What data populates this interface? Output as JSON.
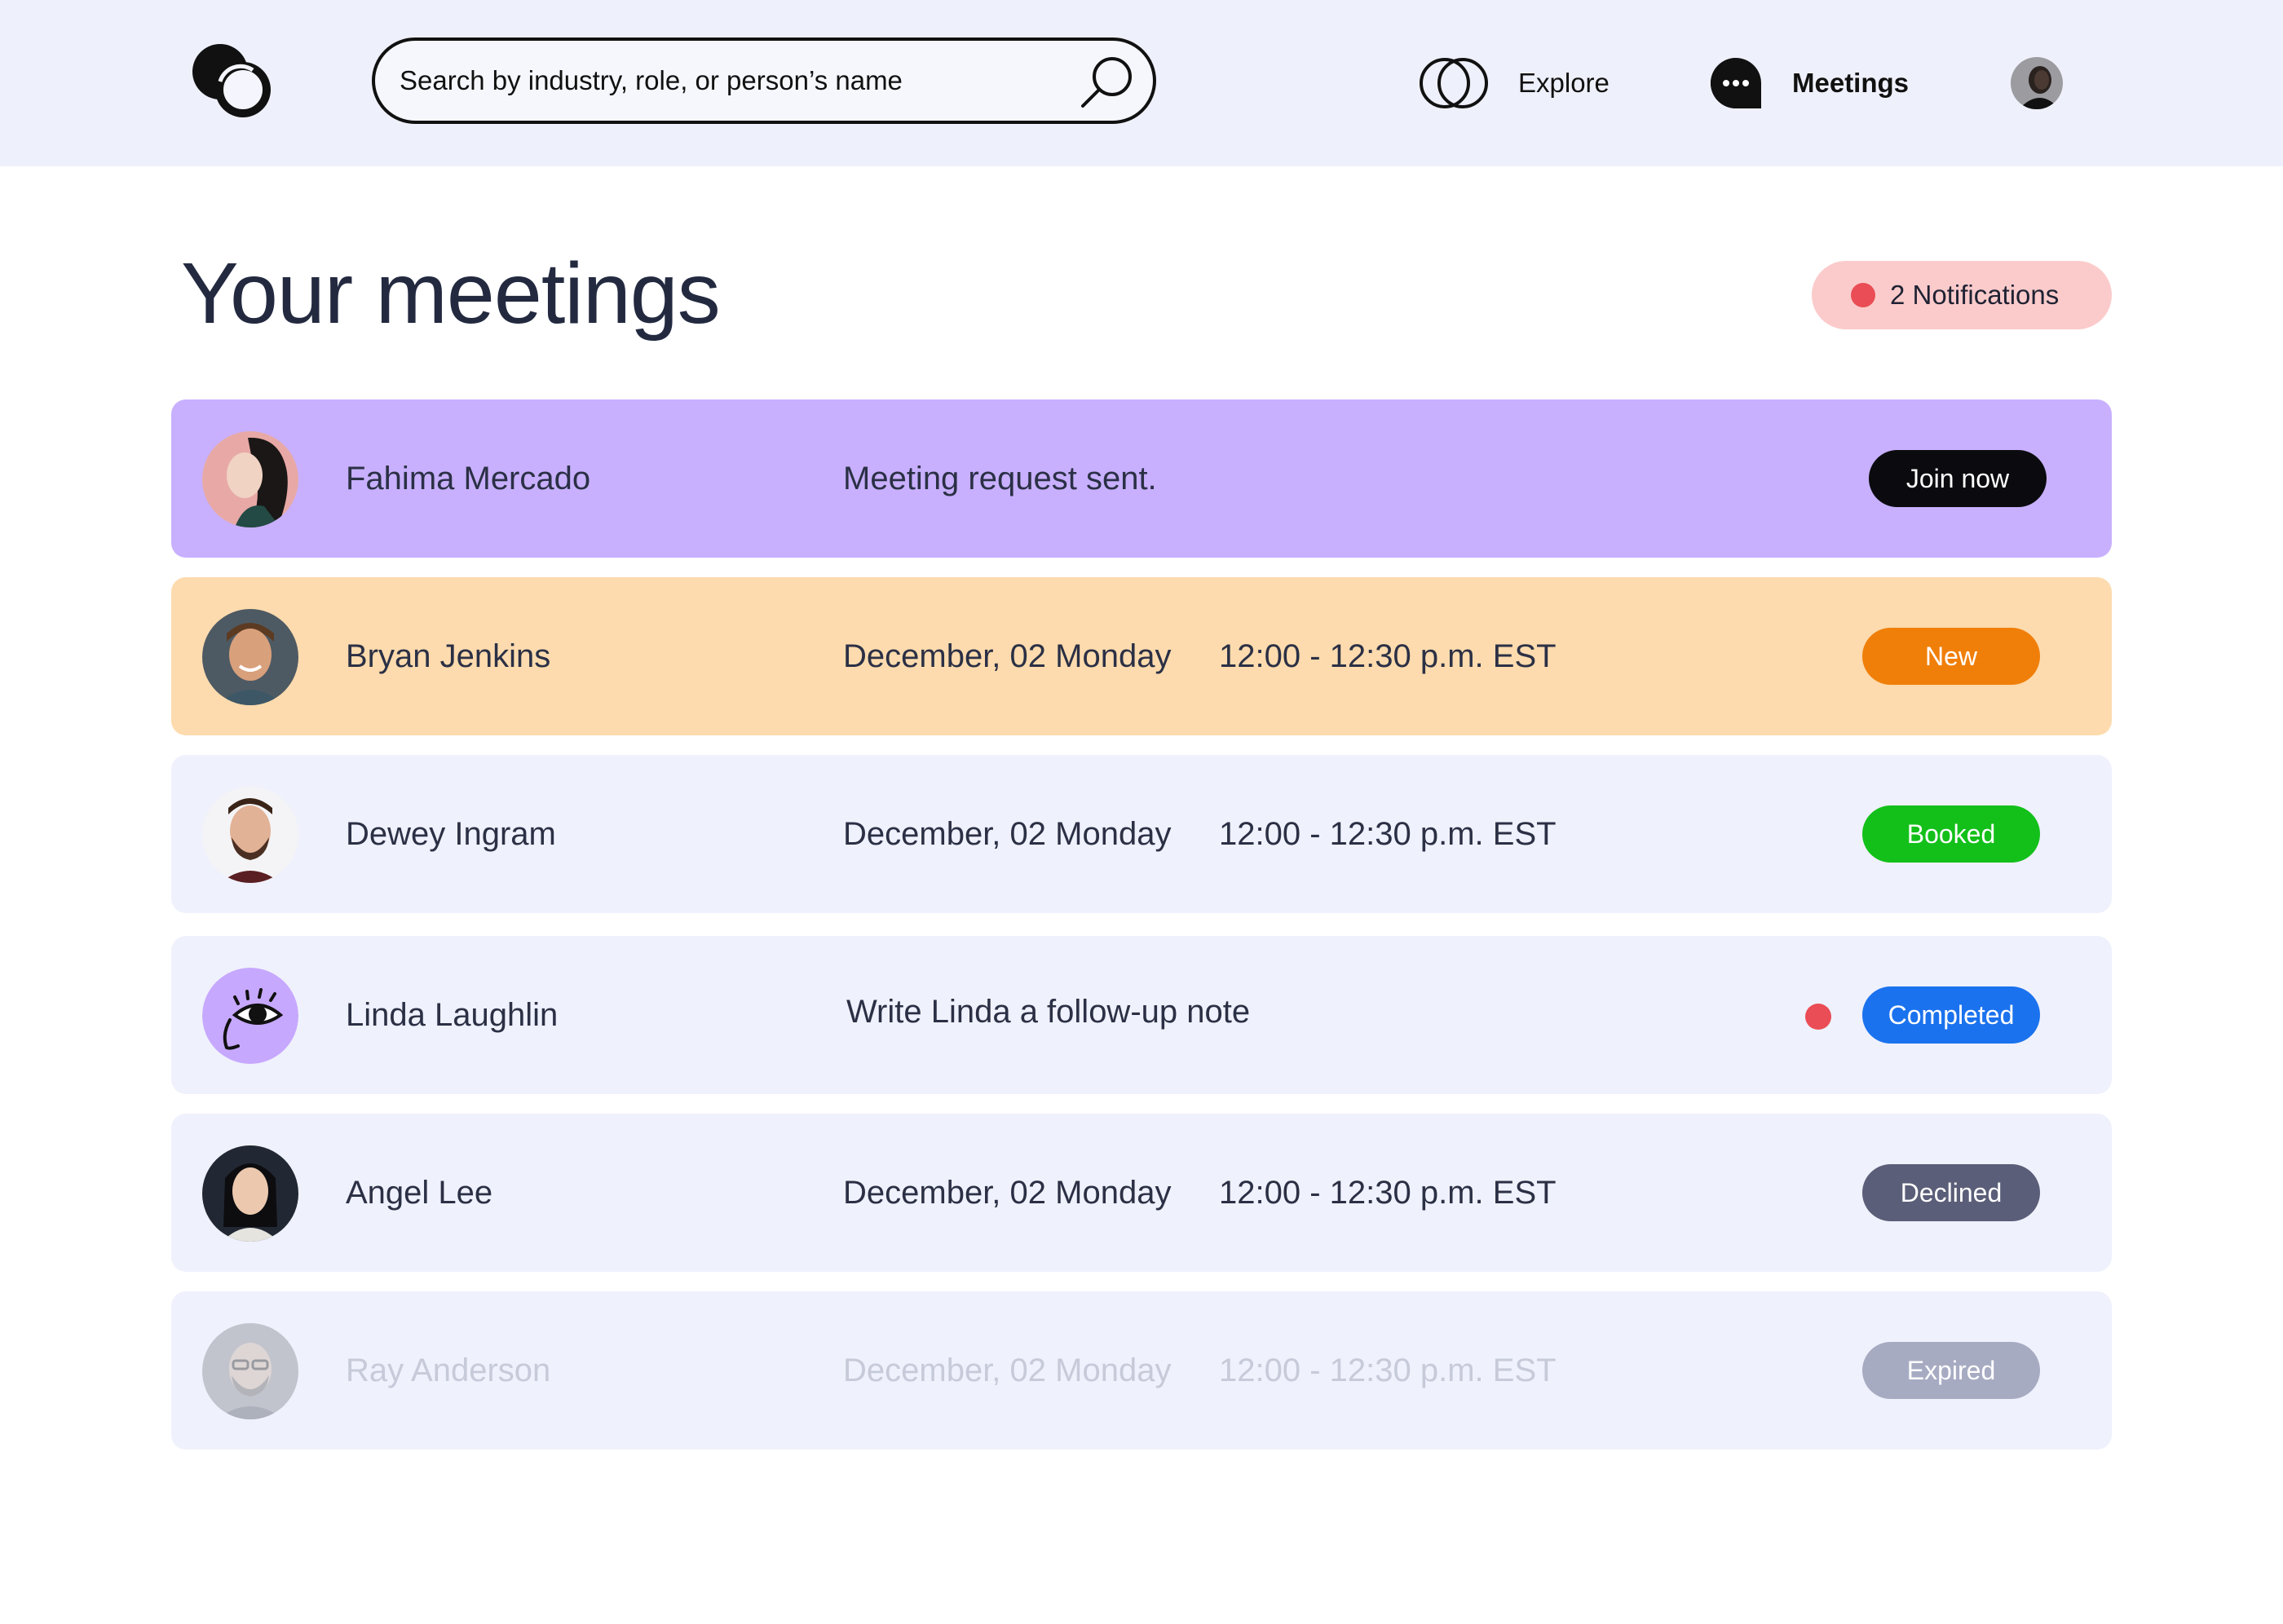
{
  "header": {
    "search_placeholder": "Search by industry, role, or person’s name",
    "nav": {
      "explore_label": "Explore",
      "meetings_label": "Meetings"
    }
  },
  "page": {
    "title": "Your meetings",
    "notifications_label": "2 Notifications"
  },
  "meetings": [
    {
      "name": "Fahima Mercado",
      "message": "Meeting request sent.",
      "action": "Join now",
      "color": "#c8b0ff"
    },
    {
      "name": "Bryan Jenkins",
      "date": "December, 02 Monday",
      "time": "12:00 - 12:30 p.m. EST",
      "status": "New",
      "color": "#fddbae",
      "status_color": "#f07f0a"
    },
    {
      "name": "Dewey Ingram",
      "date": "December, 02 Monday",
      "time": "12:00 - 12:30 p.m. EST",
      "status": "Booked",
      "color": "#eff1fc",
      "status_color": "#13c01a"
    },
    {
      "name": "Linda Laughlin",
      "message": "Write Linda a follow-up note",
      "status": "Completed",
      "color": "#eff1fc",
      "status_color": "#1b72ee"
    },
    {
      "name": "Angel Lee",
      "date": "December, 02 Monday",
      "time": "12:00 - 12:30 p.m. EST",
      "status": "Declined",
      "color": "#eff1fc",
      "status_color": "#5b5e78"
    },
    {
      "name": "Ray Anderson",
      "date": "December, 02 Monday",
      "time": "12:00 - 12:30 p.m. EST",
      "status": "Expired",
      "color": "#eff1fc",
      "status_color": "#a7abc2"
    }
  ],
  "colors": {
    "header_bg": "#eef0fb",
    "notification_dot": "#ea4d55",
    "notification_bg": "#fbcbcb"
  },
  "icons": [
    "logo-icon",
    "search-icon",
    "explore-icon",
    "meetings-chat-icon",
    "eye-face-icon"
  ]
}
